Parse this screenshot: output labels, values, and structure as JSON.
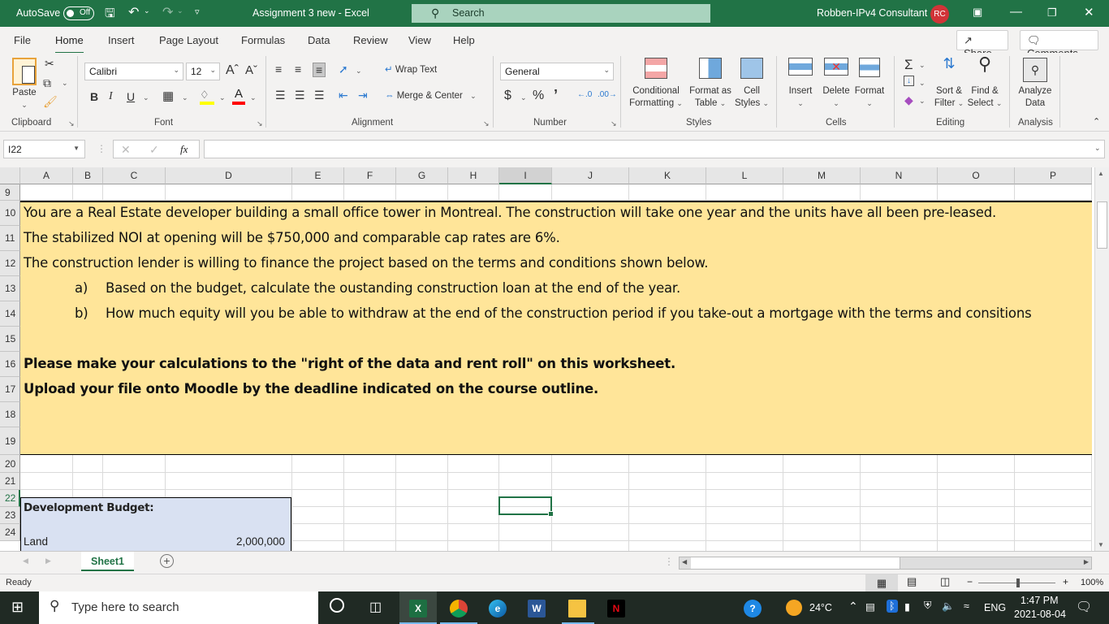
{
  "titlebar": {
    "autosave_label": "AutoSave",
    "autosave_state": "Off",
    "document_title": "Assignment 3 new  -  Excel",
    "search_placeholder": "Search",
    "user_name": "Robben-IPv4 Consultant",
    "user_initials": "RC"
  },
  "menu": {
    "tabs": [
      "File",
      "Home",
      "Insert",
      "Page Layout",
      "Formulas",
      "Data",
      "Review",
      "View",
      "Help"
    ],
    "active_tab": "Home",
    "share_label": "Share",
    "comments_label": "Comments"
  },
  "ribbon": {
    "clipboard": {
      "paste": "Paste",
      "group": "Clipboard"
    },
    "font": {
      "name": "Calibri",
      "size": "12",
      "group": "Font",
      "bold": "B",
      "italic": "I",
      "underline": "U",
      "highlight_color": "#ffff00",
      "font_color": "#ff0000"
    },
    "alignment": {
      "wrap_text": "Wrap Text",
      "merge_center": "Merge & Center",
      "group": "Alignment"
    },
    "number": {
      "format": "General",
      "currency": "$",
      "percent": "%",
      "comma": "’",
      "group": "Number"
    },
    "styles": {
      "conditional_formatting": [
        "Conditional",
        "Formatting"
      ],
      "format_as_table": [
        "Format as",
        "Table"
      ],
      "cell_styles": [
        "Cell",
        "Styles"
      ],
      "group": "Styles"
    },
    "cells": {
      "insert": "Insert",
      "delete": "Delete",
      "format": "Format",
      "group": "Cells"
    },
    "editing": {
      "sort_filter": [
        "Sort &",
        "Filter"
      ],
      "find_select": [
        "Find &",
        "Select"
      ],
      "group": "Editing"
    },
    "analysis": {
      "analyze_data": [
        "Analyze",
        "Data"
      ],
      "group": "Analysis"
    }
  },
  "formula_bar": {
    "name_box": "I22",
    "formula": ""
  },
  "grid": {
    "columns": [
      "A",
      "B",
      "C",
      "D",
      "E",
      "F",
      "G",
      "H",
      "I",
      "J",
      "K",
      "L",
      "M",
      "N",
      "O",
      "P"
    ],
    "selected_column": "I",
    "rows": [
      "9",
      "10",
      "11",
      "12",
      "13",
      "14",
      "15",
      "16",
      "17",
      "18",
      "19",
      "20",
      "21",
      "22",
      "23",
      "24"
    ],
    "selected_row": "22",
    "active_cell": "I22",
    "text_rows": [
      {
        "row": "10",
        "text": "You are a Real Estate developer building a small office tower in Montreal.  The construction will take one year and the units have all been pre-leased.",
        "bold": false
      },
      {
        "row": "11",
        "text": "The stabilized NOI at opening will be $750,000 and comparable cap rates are 6%.",
        "bold": false
      },
      {
        "row": "12",
        "text": "The construction lender is willing to finance the project based on the terms and conditions shown below.",
        "bold": false
      },
      {
        "row": "16",
        "text": "Please make your calculations to the \"right of the data and rent roll\" on this worksheet.",
        "bold": true
      },
      {
        "row": "17",
        "text": "Upload your file onto Moodle by the deadline indicated on the course outline.",
        "bold": true
      }
    ],
    "list_items": [
      {
        "row": "13",
        "marker": "a)",
        "text": "Based on the budget, calculate the oustanding construction loan at the end of the year."
      },
      {
        "row": "14",
        "marker": "b)",
        "text": "How much equity will you be able to withdraw at the end of the construction period if you take-out a mortgage with the terms and consitions"
      }
    ],
    "budget": {
      "title": "Development Budget:",
      "items": [
        {
          "label": "Land",
          "value": "2,000,000"
        }
      ]
    },
    "highlight_color": "#ffe599",
    "budget_color": "#d9e1f2"
  },
  "sheets": {
    "tabs": [
      "Sheet1"
    ],
    "active": "Sheet1"
  },
  "status": {
    "state": "Ready",
    "zoom": "100%"
  },
  "taskbar": {
    "search_placeholder": "Type here to search",
    "weather": "24°C",
    "language": "ENG",
    "time": "1:47 PM",
    "date": "2021-08-04"
  }
}
